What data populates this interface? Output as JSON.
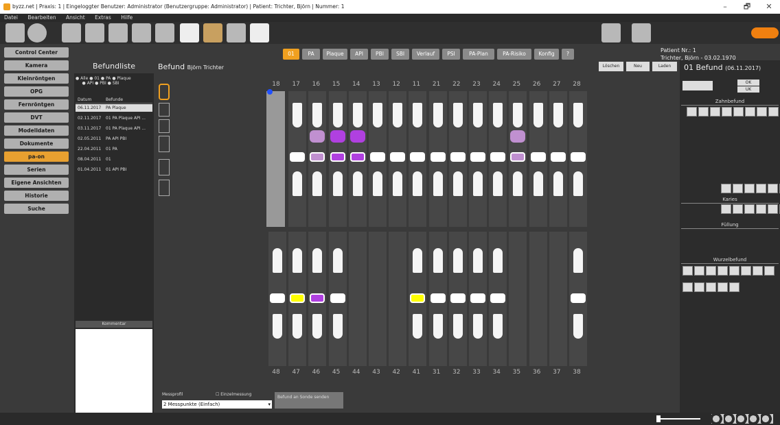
{
  "window": {
    "title": "byzz.net | Praxis: 1 | Eingeloggter Benutzer: Administrator (Benutzergruppe: Administrator) | Patient: Trichter, Björn | Nummer: 1",
    "minimize": "–",
    "maximize": "🗗",
    "close": "✕"
  },
  "menu": [
    "Datei",
    "Bearbeiten",
    "Ansicht",
    "Extras",
    "Hilfe"
  ],
  "patient": {
    "nr": "Patient Nr.: 1",
    "name": "Trichter, Björn - 03.02.1970"
  },
  "nav": [
    "Control Center",
    "Kamera",
    "Kleinröntgen",
    "OPG",
    "Fernröntgen",
    "DVT",
    "Modelldaten",
    "Dokumente",
    "pa-on",
    "Serien",
    "Eigene Ansichten",
    "Historie",
    "Suche"
  ],
  "tabs": [
    "01",
    "PA",
    "Plaque",
    "API",
    "PBI",
    "SBI",
    "Verlauf",
    "PSI",
    "PA-Plan",
    "PA-Risiko",
    "Konfig",
    "?"
  ],
  "befundliste": {
    "title": "Befundliste",
    "filters": [
      "Alle",
      "01",
      "PA",
      "Plaque",
      "API",
      "PBI",
      "SBI"
    ],
    "col_datum": "Datum",
    "col_befunde": "Befunde",
    "rows": [
      [
        "06.11.2017",
        "PA Plaque"
      ],
      [
        "02.11.2017",
        "01 PA Plaque API ..."
      ],
      [
        "03.11.2017",
        "01 PA Plaque API ..."
      ],
      [
        "02.05.2011",
        "PA API PBI"
      ],
      [
        "22.04.2011",
        "01 PA"
      ],
      [
        "08.04.2011",
        "01"
      ],
      [
        "01.04.2011",
        "01 API PBI"
      ]
    ],
    "kommentar": "Kommentar"
  },
  "befund": {
    "title": "Befund",
    "patient": "Björn Trichter",
    "buttons": [
      "Löschen",
      "Neu",
      "Laden"
    ]
  },
  "upper_nums": [
    "18",
    "17",
    "16",
    "15",
    "14",
    "13",
    "12",
    "11",
    "21",
    "22",
    "23",
    "24",
    "25",
    "26",
    "27",
    "28"
  ],
  "lower_nums": [
    "48",
    "47",
    "46",
    "45",
    "44",
    "43",
    "42",
    "41",
    "31",
    "32",
    "33",
    "34",
    "35",
    "36",
    "37",
    "38"
  ],
  "messprofil": {
    "label": "Messprofil",
    "value": "2 Messpunkte (Einfach)",
    "einzel": "Einzelmessung",
    "sende": "Befund an Sonde senden"
  },
  "right": {
    "title": "01 Befund",
    "date": "(06.11.2017)",
    "ok": "OK",
    "uk": "UK",
    "zahnbefund": "Zahnbefund",
    "karies": "Karies",
    "fuellung": "Füllung",
    "wurzelbefund": "Wurzelbefund"
  },
  "colors": {
    "accent": "#f0a020",
    "purple": "#b040e0",
    "yellow": "#ffff00"
  }
}
